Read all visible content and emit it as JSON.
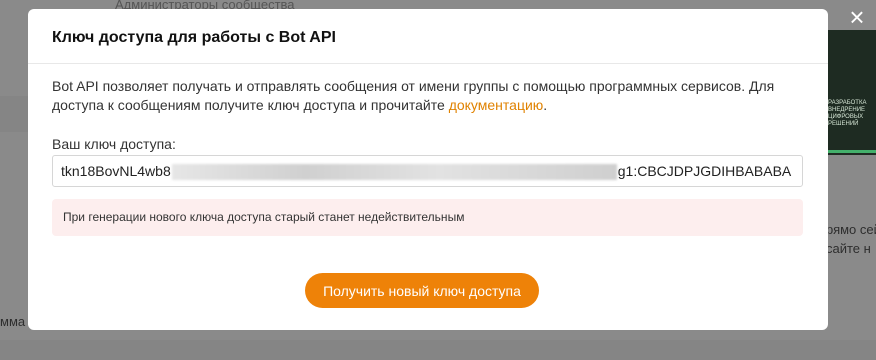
{
  "dialog": {
    "title": "Ключ доступа для работы с Bot API",
    "description_text": "Bot API позволяет получать и отправлять сообщения от имени группы с помощью программных сервисов. Для доступа к сообщениям получите ключ доступа и прочитайте ",
    "docs_link": "документацию",
    "description_end": ".",
    "key_label": "Ваш ключ доступа:",
    "key_prefix": "tkn18BovNL4wb8",
    "key_suffix": "g1:CBCJDPJGDIHBABABA",
    "warning": "При генерации нового ключа доступа старый станет недействительным",
    "generate_button": "Получить новый ключ доступа",
    "close_glyph": "×"
  },
  "background": {
    "top_text": "Администраторы сообщества",
    "right_text_1": "рямо сей",
    "right_text_2": "сайте н",
    "left_text": "мма"
  },
  "colors": {
    "accent": "#ee8208",
    "link": "#e08200",
    "warning_bg": "#fdeeee"
  }
}
